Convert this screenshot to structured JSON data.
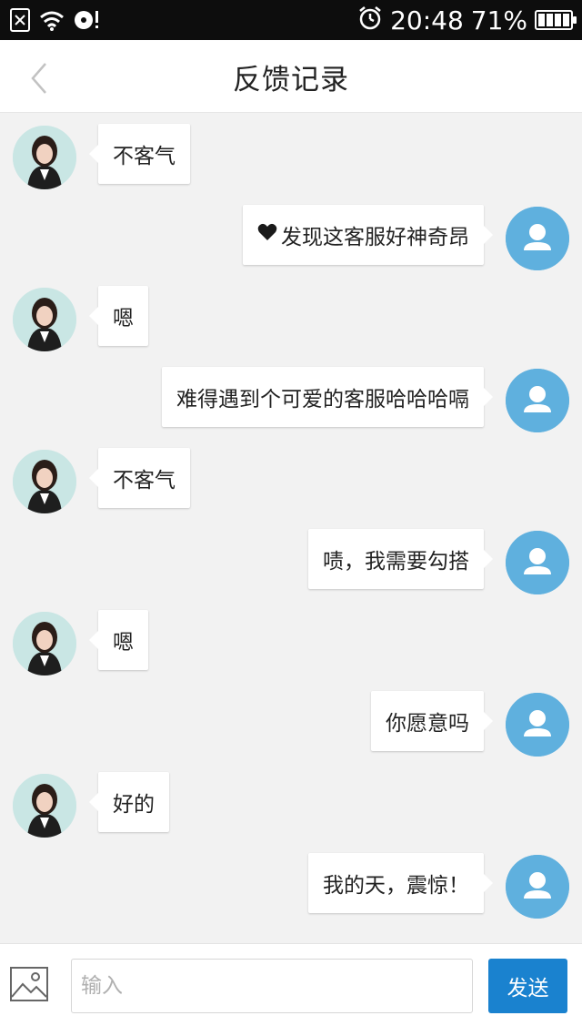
{
  "status_bar": {
    "time": "20:48",
    "battery_percent": "71%",
    "icons": [
      "no-sim-icon",
      "wifi-icon",
      "cd-alert-icon",
      "alarm-icon",
      "battery-icon"
    ]
  },
  "nav": {
    "title": "反馈记录",
    "back_icon": "chevron-left-icon"
  },
  "messages": [
    {
      "side": "agent",
      "text": "不客气"
    },
    {
      "side": "user",
      "text": "发现这客服好神奇昂",
      "prefix_icon": "heart-icon"
    },
    {
      "side": "agent",
      "text": "嗯"
    },
    {
      "side": "user",
      "text": "难得遇到个可爱的客服哈哈哈嗝"
    },
    {
      "side": "agent",
      "text": "不客气"
    },
    {
      "side": "user",
      "text": "啧，我需要勾搭"
    },
    {
      "side": "agent",
      "text": "嗯"
    },
    {
      "side": "user",
      "text": "你愿意吗"
    },
    {
      "side": "agent",
      "text": "好的"
    },
    {
      "side": "user",
      "text": "我的天，震惊！"
    }
  ],
  "input_bar": {
    "image_icon": "image-icon",
    "placeholder": "输入",
    "value": "",
    "send_label": "发送"
  },
  "colors": {
    "accent": "#1a82cf",
    "user_avatar": "#5fb0de",
    "background": "#f2f2f2"
  }
}
